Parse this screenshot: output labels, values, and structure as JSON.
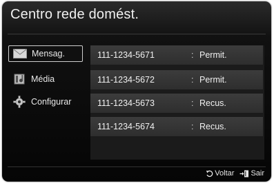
{
  "header": {
    "title": "Centro rede domést."
  },
  "sidebar": {
    "items": [
      {
        "label": "Mensag.",
        "icon": "envelope-icon",
        "active": true
      },
      {
        "label": "Média",
        "icon": "media-icon",
        "active": false
      },
      {
        "label": "Configurar",
        "icon": "gear-icon",
        "active": false
      }
    ]
  },
  "devices": [
    {
      "number": "111-1234-5671",
      "separator": ":",
      "status": "Permit."
    },
    {
      "number": "111-1234-5672",
      "separator": ":",
      "status": "Permit."
    },
    {
      "number": "111-1234-5673",
      "separator": ":",
      "status": "Recus."
    },
    {
      "number": "111-1234-5674",
      "separator": ":",
      "status": "Recus."
    }
  ],
  "footer": {
    "back_label": "Voltar",
    "back_icon": "return-icon",
    "exit_label": "Sair",
    "exit_icon": "exit-icon"
  }
}
